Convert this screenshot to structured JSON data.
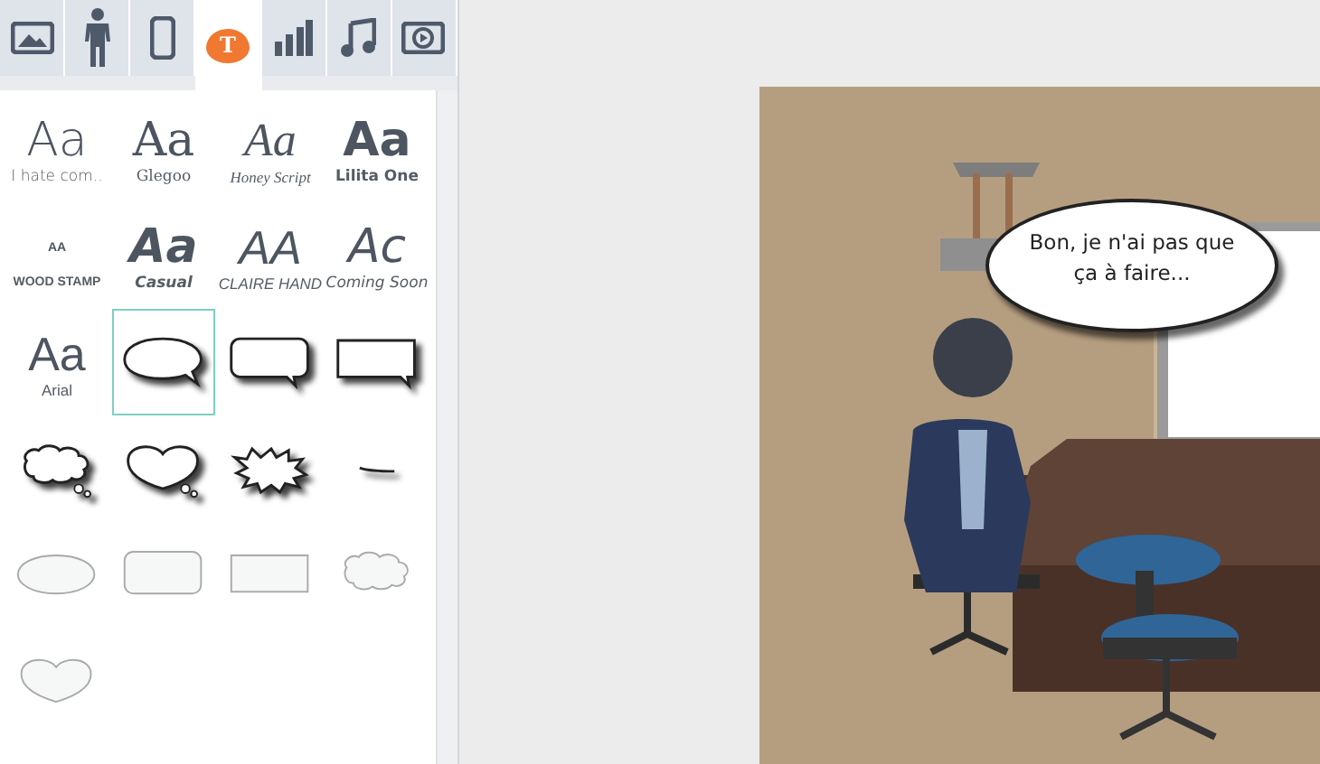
{
  "tabs": [
    {
      "kind": "image",
      "selected": false
    },
    {
      "kind": "person",
      "selected": false
    },
    {
      "kind": "phone",
      "selected": false
    },
    {
      "kind": "text",
      "glyph": "T",
      "selected": true
    },
    {
      "kind": "chart",
      "selected": false
    },
    {
      "kind": "music",
      "selected": false
    },
    {
      "kind": "video",
      "selected": false
    }
  ],
  "items": [
    {
      "kind": "font",
      "sample": "Aa",
      "label": "I hate com.."
    },
    {
      "kind": "font",
      "sample": "Aa",
      "label": "Glegoo"
    },
    {
      "kind": "font",
      "sample": "Aa",
      "label": "Honey Script"
    },
    {
      "kind": "font",
      "sample": "Aa",
      "label": "Lilita One"
    },
    {
      "kind": "font",
      "sample": "AA",
      "label": "WOOD STAMP"
    },
    {
      "kind": "font",
      "sample": "Aa",
      "label": "Casual"
    },
    {
      "kind": "font",
      "sample": "AA",
      "label": "CLAIRE HAND"
    },
    {
      "kind": "font",
      "sample": "Ac",
      "label": "Coming Soon"
    },
    {
      "kind": "font",
      "sample": "Aa",
      "label": "Arial"
    },
    {
      "kind": "bubble",
      "selected": true
    },
    {
      "kind": "bubble",
      "selected": false
    },
    {
      "kind": "bubble",
      "selected": false
    },
    {
      "kind": "bubble",
      "selected": false
    },
    {
      "kind": "bubble",
      "selected": false
    },
    {
      "kind": "bubble",
      "selected": false
    },
    {
      "kind": "bubble",
      "selected": false
    },
    {
      "kind": "bubble",
      "selected": false
    },
    {
      "kind": "bubble",
      "selected": false
    },
    {
      "kind": "bubble",
      "selected": false
    },
    {
      "kind": "bubble",
      "selected": false
    },
    {
      "kind": "bubble",
      "selected": false
    }
  ],
  "scene": {
    "speech": "Bon, je n'ai pas que ça à faire..."
  }
}
